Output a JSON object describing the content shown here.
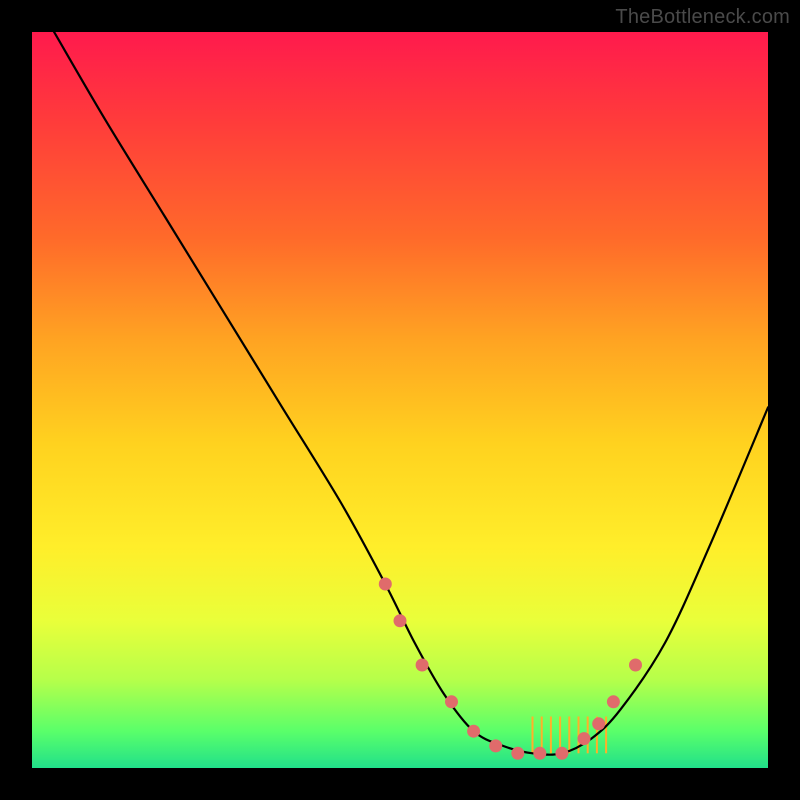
{
  "watermark": "TheBottleneck.com",
  "chart_data": {
    "type": "line",
    "title": "",
    "xlabel": "",
    "ylabel": "",
    "xlim": [
      0,
      100
    ],
    "ylim": [
      0,
      100
    ],
    "series": [
      {
        "name": "bottleneck-curve",
        "x": [
          3,
          10,
          18,
          26,
          34,
          42,
          48,
          52,
          56,
          60,
          64,
          68,
          72,
          76,
          80,
          86,
          92,
          100
        ],
        "y": [
          100,
          88,
          75,
          62,
          49,
          36,
          25,
          17,
          10,
          5,
          3,
          2,
          2,
          4,
          8,
          17,
          30,
          49
        ]
      }
    ],
    "markers": {
      "name": "highlight-dots",
      "color": "#e06b6b",
      "x": [
        48,
        50,
        53,
        57,
        60,
        63,
        66,
        69,
        72,
        75,
        77,
        79,
        82
      ],
      "y": [
        25,
        20,
        14,
        9,
        5,
        3,
        2,
        2,
        2,
        4,
        6,
        9,
        14
      ]
    },
    "hatch_region": {
      "name": "optimal-zone-hatch",
      "color": "#ffb02a",
      "x_start": 68,
      "x_end": 78,
      "y_top": 7,
      "y_bottom": 2
    }
  }
}
